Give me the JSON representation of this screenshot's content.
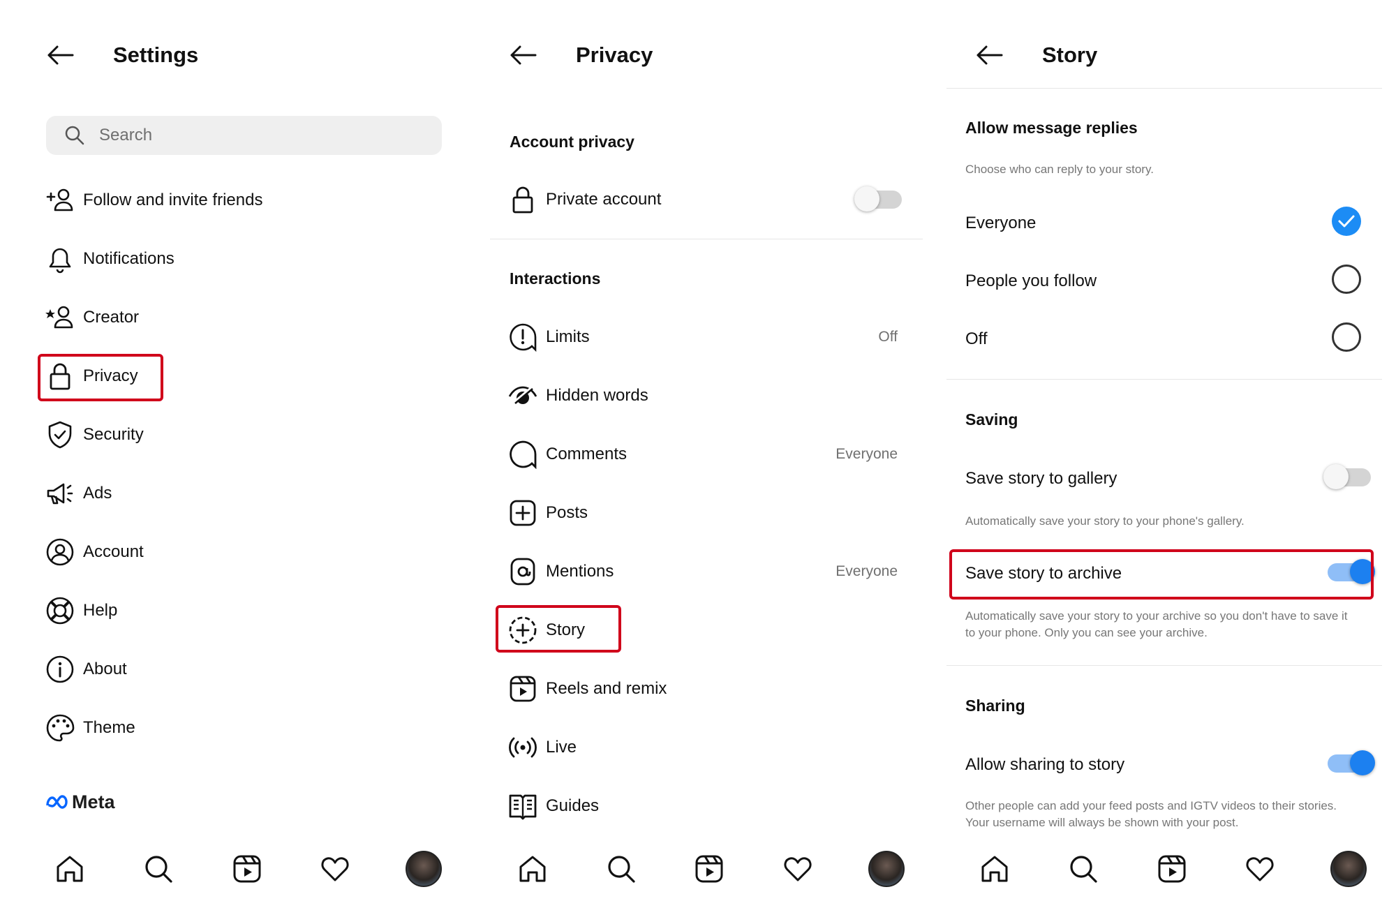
{
  "panel1": {
    "title": "Settings",
    "search_placeholder": "Search",
    "items": [
      {
        "label": "Follow and invite friends",
        "icon": "add-user-icon"
      },
      {
        "label": "Notifications",
        "icon": "bell-icon"
      },
      {
        "label": "Creator",
        "icon": "creator-icon"
      },
      {
        "label": "Privacy",
        "icon": "lock-icon"
      },
      {
        "label": "Security",
        "icon": "shield-check-icon"
      },
      {
        "label": "Ads",
        "icon": "megaphone-icon"
      },
      {
        "label": "Account",
        "icon": "user-circle-icon"
      },
      {
        "label": "Help",
        "icon": "lifebuoy-icon"
      },
      {
        "label": "About",
        "icon": "info-icon"
      },
      {
        "label": "Theme",
        "icon": "palette-icon"
      }
    ],
    "meta_label": "Meta"
  },
  "panel2": {
    "title": "Privacy",
    "section_account": "Account privacy",
    "private_account": {
      "label": "Private account",
      "enabled": false
    },
    "section_interactions": "Interactions",
    "items": [
      {
        "label": "Limits",
        "value": "Off",
        "icon": "limits-icon"
      },
      {
        "label": "Hidden words",
        "value": "",
        "icon": "hidden-words-icon"
      },
      {
        "label": "Comments",
        "value": "Everyone",
        "icon": "comment-icon"
      },
      {
        "label": "Posts",
        "value": "",
        "icon": "plus-square-icon"
      },
      {
        "label": "Mentions",
        "value": "Everyone",
        "icon": "at-sign-icon"
      },
      {
        "label": "Story",
        "value": "",
        "icon": "story-add-icon"
      },
      {
        "label": "Reels and remix",
        "value": "",
        "icon": "reels-icon"
      },
      {
        "label": "Live",
        "value": "",
        "icon": "live-icon"
      },
      {
        "label": "Guides",
        "value": "",
        "icon": "guides-icon"
      }
    ]
  },
  "panel3": {
    "title": "Story",
    "replies": {
      "heading": "Allow message replies",
      "description": "Choose who can reply to your story.",
      "options": [
        {
          "label": "Everyone",
          "selected": true
        },
        {
          "label": "People you follow",
          "selected": false
        },
        {
          "label": "Off",
          "selected": false
        }
      ]
    },
    "saving": {
      "heading": "Saving",
      "gallery_label": "Save story to gallery",
      "gallery_enabled": false,
      "gallery_desc": "Automatically save your story to your phone's gallery.",
      "archive_label": "Save story to archive",
      "archive_enabled": true,
      "archive_desc": "Automatically save your story to your archive so you don't have to save it to your phone. Only you can see your archive."
    },
    "sharing": {
      "heading": "Sharing",
      "allow_label": "Allow sharing to story",
      "allow_enabled": true,
      "allow_desc": "Other people can add your feed posts and IGTV videos to their stories. Your username will always be shown with your post."
    }
  },
  "tabbar": [
    "home-icon",
    "search-icon",
    "reels-icon",
    "heart-icon",
    "profile-avatar"
  ],
  "colors": {
    "accent": "#1c80f0",
    "highlight": "#d0021b"
  }
}
